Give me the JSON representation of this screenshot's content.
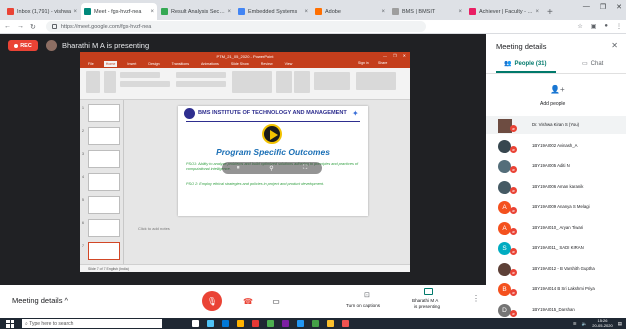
{
  "browser": {
    "tabs": [
      {
        "label": "Inbox (1,791) - vishwa",
        "favicon_color": "#ea4335",
        "active": false
      },
      {
        "label": "Meet - fgs-hvzf-nea",
        "favicon_color": "#00897b",
        "active": true
      },
      {
        "label": "Result Analysis Second",
        "favicon_color": "#34a853",
        "active": false
      },
      {
        "label": "Embedded Systems",
        "favicon_color": "#4285f4",
        "active": false
      },
      {
        "label": "Adobe",
        "favicon_color": "#ff6f00",
        "active": false
      },
      {
        "label": "BMS | BMSIT",
        "favicon_color": "#9e9e9e",
        "active": false
      },
      {
        "label": "Achiever | Faculty - Atte",
        "favicon_color": "#e91e63",
        "active": false
      }
    ],
    "url": "https://meet.google.com/fgs-hvzf-nea",
    "window_controls": [
      "—",
      "❐",
      "✕"
    ]
  },
  "meet": {
    "rec_label": "REC",
    "presenting_text": "Bharathi M A is presenting",
    "panel": {
      "title": "Meeting details",
      "people_tab": "People (31)",
      "chat_tab": "Chat",
      "add_people": "Add people",
      "participants": [
        {
          "name": "Dr. Vishwa Kiran S (You)",
          "initial": "",
          "color": "#6d4c41",
          "photo": true
        },
        {
          "name": "1BY19AI002 Avinash_A",
          "initial": "",
          "color": "#37474f",
          "photo": false
        },
        {
          "name": "1BY19AI005 Aditi N",
          "initial": "",
          "color": "#546e7a",
          "photo": false
        },
        {
          "name": "1BY19AI006 Aman karanik",
          "initial": "",
          "color": "#455a64",
          "photo": false
        },
        {
          "name": "1BY19AI009 Ananya S Melagi",
          "initial": "A",
          "color": "#f4511e",
          "photo": false
        },
        {
          "name": "1BY19AI010_ Aryan Tiwari",
          "initial": "A",
          "color": "#f4511e",
          "photo": false
        },
        {
          "name": "1BY19AI011_ SADI KIRAN",
          "initial": "S",
          "color": "#00acc1",
          "photo": false
        },
        {
          "name": "1BY19AI012 - B Varshith Guptha",
          "initial": "",
          "color": "#5d4037",
          "photo": false
        },
        {
          "name": "1BY19AI014 B Sri Lakshmi Priya",
          "initial": "B",
          "color": "#f4511e",
          "photo": false
        },
        {
          "name": "1BY19AI015_Darshan",
          "initial": "D",
          "color": "#757575",
          "photo": false
        }
      ]
    },
    "bottom": {
      "meeting_details": "Meeting details",
      "captions": "Turn on captions",
      "presenting_name": "Bharathi M A",
      "presenting_status": "is presenting"
    }
  },
  "ppt": {
    "window_title": "PTM_21_05_2020 - PowerPoint",
    "window_controls": [
      "—",
      "❐",
      "✕"
    ],
    "tabs": [
      "File",
      "Home",
      "Insert",
      "Design",
      "Transitions",
      "Animations",
      "Slide Show",
      "Review",
      "View"
    ],
    "sign_in": "Sign in",
    "share": "Share",
    "notes_placeholder": "Click to add notes",
    "status": "Slide 7 of 7   English (India)",
    "slide": {
      "college": "BMS INSTITUTE OF TECHNOLOGY AND MANAGEMENT",
      "heading": "Program Specific Outcomes",
      "pso1": "PSO1: Ability to analyze problems and build optimized solutions adhering to principles and practices of computational intelligence.",
      "pso2": "PSO 2: Employ ethical strategies and policies  in project  and product development."
    },
    "thumb_numbers": [
      "1",
      "2",
      "3",
      "4",
      "5",
      "6",
      "7"
    ]
  },
  "taskbar": {
    "search_placeholder": "Type here to search",
    "time": "15:26",
    "date": "20-05-2020",
    "icon_colors": [
      "#ffffff",
      "#4fc3f7",
      "#0078d7",
      "#ffb300",
      "#e53935",
      "#4caf50",
      "#7b1fa2",
      "#2196f3",
      "#43a047",
      "#fbc02d",
      "#ef5350"
    ]
  }
}
